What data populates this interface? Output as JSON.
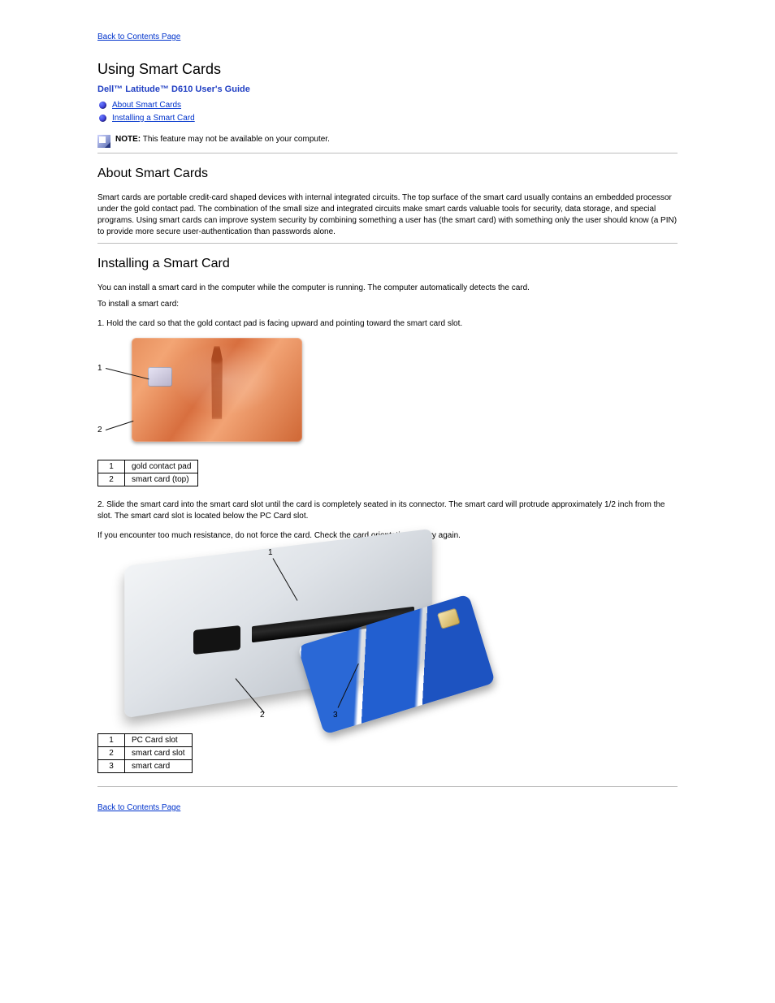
{
  "nav": {
    "back_top": "Back to Contents Page",
    "back_bottom": "Back to Contents Page"
  },
  "page_title": "Using Smart Cards",
  "guide_title": "Dell™ Latitude™ D610 User's Guide",
  "toc": [
    "About Smart Cards",
    "Installing a Smart Card"
  ],
  "note": {
    "label": "NOTE:",
    "text": "This feature may not be available on your computer."
  },
  "about": {
    "heading": "About Smart Cards",
    "p1": "Smart cards are portable credit-card shaped devices with internal integrated circuits. The top surface of the smart card usually contains an embedded processor under the gold contact pad. The combination of the small size and integrated circuits make smart cards valuable tools for security, data storage, and special programs. Using smart cards can improve system security by combining something a user has (the smart card) with something only the user should know (a PIN) to provide more secure user-authentication than passwords alone."
  },
  "install": {
    "heading": "Installing a Smart Card",
    "intro": "You can install a smart card in the computer while the computer is running. The computer automatically detects the card.",
    "step_lead": "To install a smart card:",
    "step1_label": "1.",
    "step1_text": "Hold the card so that the gold contact pad is facing upward and pointing toward the smart card slot.",
    "step2_label": "2.",
    "step2_text": "Slide the smart card into the smart card slot until the card is completely seated in its connector. The smart card will protrude approximately 1/2 inch from the slot. The smart card slot is located below the PC Card slot.",
    "step2_tail": "If you encounter too much resistance, do not force the card. Check the card orientation and try again."
  },
  "legend1": [
    {
      "num": "1",
      "label": "gold contact pad"
    },
    {
      "num": "2",
      "label": "smart card (top)"
    }
  ],
  "legend2": [
    {
      "num": "1",
      "label": "PC Card slot"
    },
    {
      "num": "2",
      "label": "smart card slot"
    },
    {
      "num": "3",
      "label": "smart card"
    }
  ],
  "callouts_fig1": {
    "c1": "1",
    "c2": "2"
  },
  "callouts_fig2": {
    "c1": "1",
    "c2": "2",
    "c3": "3"
  }
}
